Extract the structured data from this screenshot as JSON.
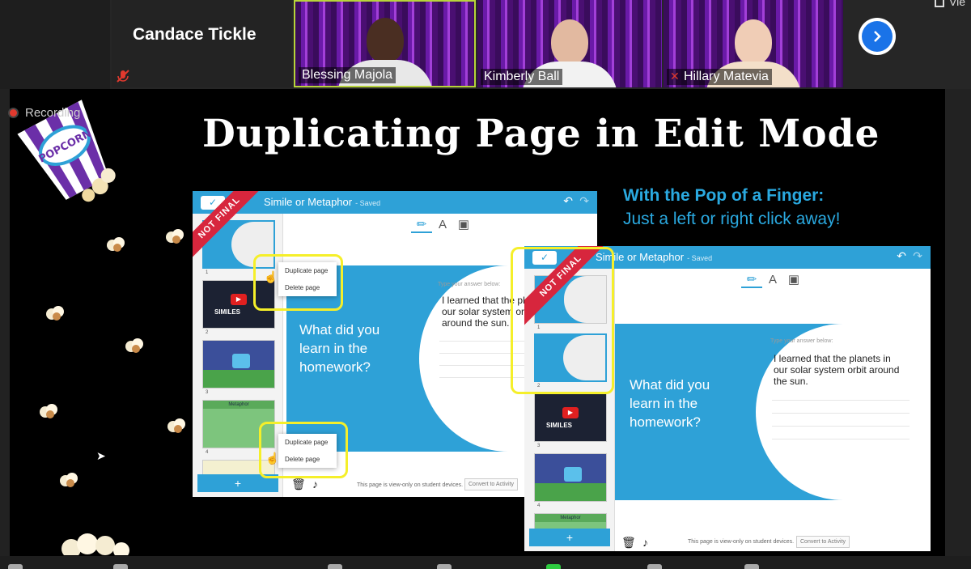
{
  "meeting": {
    "self_tile_name": "Candace Tickle",
    "participants": [
      {
        "name": "Blessing Majola",
        "muted": false
      },
      {
        "name": "Kimberly Ball",
        "muted": false
      },
      {
        "name": "Hillary Matevia",
        "muted": true
      }
    ],
    "next_page_icon": "chevron-right-icon",
    "view_label": "Vie",
    "recording_label": "Recording"
  },
  "slide": {
    "title": "Duplicating Page in Edit Mode",
    "tagline_bold": "With the Pop of a Finger:",
    "tagline": "Just a left or right click away!",
    "bucket_label": "POPCORN",
    "colors": {
      "accent": "#2ea1d7",
      "highlight": "#f5ef2a",
      "ribbon": "#d7263d",
      "tagline": "#2aa9e0"
    }
  },
  "editor_left": {
    "title": "Simile or Metaphor",
    "saved": "- Saved",
    "ribbon": "NOT FINAL",
    "question": "What did you learn in the homework?",
    "answer_label": "Type your answer below:",
    "answer": "I learned that the planets in our solar system orbit around the sun.",
    "footer_text": "This page is view-only on student devices.",
    "convert_label": "Convert to Activity",
    "context_menu": [
      "Duplicate page",
      "Delete page"
    ],
    "thumb_numbers": [
      "1",
      "2",
      "3",
      "4"
    ],
    "thumb_similes": "SIMILES",
    "thumb_metaphor": "Metaphor",
    "add_label": "+"
  },
  "editor_right": {
    "title": "Simile or Metaphor",
    "saved": "- Saved",
    "ribbon": "NOT FINAL",
    "question": "What did you learn in the homework?",
    "answer_label": "Type your answer below:",
    "answer": "I learned that the planets in our solar system orbit around the sun.",
    "footer_text": "This page is view-only on student devices.",
    "convert_label": "Convert to Activity",
    "thumb_numbers": [
      "1",
      "2",
      "3",
      "4"
    ],
    "thumb_similes": "SIMILES",
    "thumb_metaphor": "Metaphor",
    "add_label": "+"
  }
}
